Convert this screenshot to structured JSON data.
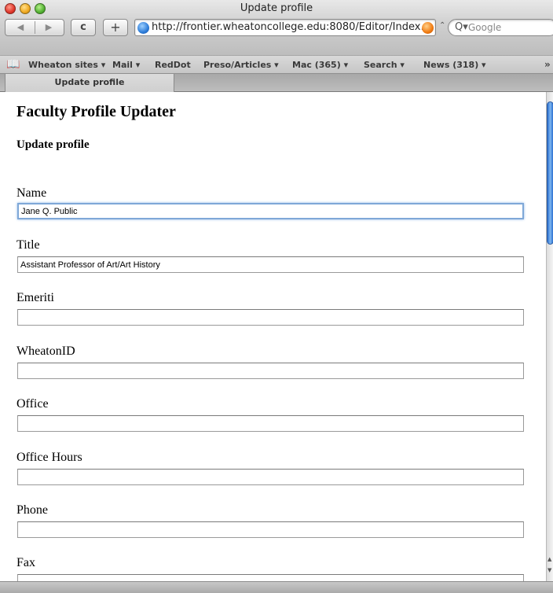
{
  "window": {
    "title": "Update profile",
    "colors": {
      "accent": "#2a6fd0",
      "focus_ring": "#7fa8d8"
    }
  },
  "toolbar": {
    "back_icon": "back-arrow-icon",
    "forward_icon": "forward-arrow-icon",
    "reload_icon": "reload-icon",
    "add_icon": "add-bookmark-icon",
    "url": "http://frontier.wheatoncollege.edu:8080/Editor/Index.cgi",
    "search_placeholder": "Google"
  },
  "bookmarks": {
    "items": [
      {
        "label": "Wheaton sites ▾"
      },
      {
        "label": "Mail ▾"
      },
      {
        "label": "RedDot"
      },
      {
        "label": "Preso/Articles ▾"
      },
      {
        "label": "Mac (365) ▾"
      },
      {
        "label": "Search ▾"
      },
      {
        "label": "News (318) ▾"
      }
    ],
    "overflow": "»"
  },
  "tabs": [
    {
      "label": "Update profile"
    }
  ],
  "page": {
    "title": "Faculty Profile Updater",
    "subtitle": "Update profile",
    "fields": [
      {
        "label": "Name",
        "value": "Jane Q. Public"
      },
      {
        "label": "Title",
        "value": "Assistant Professor of Art/Art History"
      },
      {
        "label": "Emeriti",
        "value": ""
      },
      {
        "label": "WheatonID",
        "value": ""
      },
      {
        "label": "Office",
        "value": ""
      },
      {
        "label": "Office Hours",
        "value": ""
      },
      {
        "label": "Phone",
        "value": ""
      },
      {
        "label": "Fax",
        "value": ""
      }
    ]
  }
}
